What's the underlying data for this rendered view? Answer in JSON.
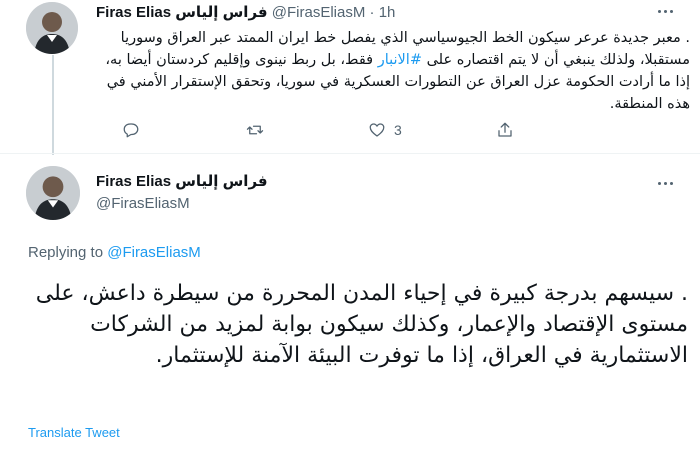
{
  "tweet1": {
    "name": "Firas Elias فراس إلياس",
    "handle": "@FirasEliasM",
    "dot": "·",
    "time": "1h",
    "text_before_hashtag": ". معبر جديدة عرعر سيكون الخط الجيوسياسي الذي يفصل خط ايران الممتد عبر العراق وسوريا مستقبلا، ولذلك ينبغي أن لا يتم اقتصاره على ",
    "hashtag": "#الانبار",
    "text_after_hashtag": " فقط، بل ربط نينوى وإقليم كردستان أيضا به، إذا ما أرادت الحكومة عزل العراق عن التطورات العسكرية في سوريا، وتحقق الإستقرار الأمني في هذه المنطقة.",
    "actions": {
      "reply_count": "",
      "retweet_count": "",
      "like_count": "3"
    }
  },
  "tweet2": {
    "name": "Firas Elias فراس إلياس",
    "handle": "@FirasEliasM",
    "replying_label": "Replying to",
    "replying_to": "@FirasEliasM",
    "text": ". سيسهم بدرجة كبيرة في إحياء المدن المحررة من سيطرة داعش، على مستوى الإقتصاد والإعمار، وكذلك سيكون بوابة لمزيد من الشركات الاستثمارية في العراق، إذا ما توفرت البيئة الآمنة للإستثمار.",
    "translate_label": "Translate Tweet"
  },
  "colors": {
    "link": "#1d9bf0",
    "muted": "#536471",
    "text": "#0f1419"
  },
  "icons": [
    "avatar",
    "more-icon",
    "reply-icon",
    "retweet-icon",
    "like-icon",
    "share-icon"
  ]
}
